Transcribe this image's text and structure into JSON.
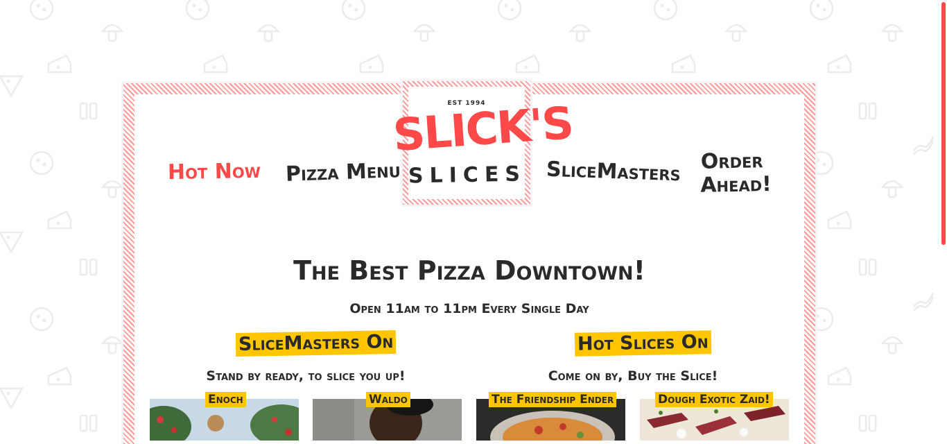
{
  "brand": {
    "established": "EST 1994",
    "name_top": "SLICK'S",
    "name_bottom": "SLICES",
    "accent_color": "#ff4949",
    "highlight_color": "#ffc600"
  },
  "nav": {
    "items": [
      {
        "label": "Hot Now",
        "active": true
      },
      {
        "label": "Pizza Menu",
        "active": false
      },
      {
        "label": "SliceMasters",
        "active": false
      },
      {
        "label": "Order Ahead!",
        "active": false
      }
    ]
  },
  "main": {
    "title": "The Best Pizza Downtown!",
    "hours": "Open 11am to 11pm Every Single Day"
  },
  "slicemasters": {
    "title": "SliceMasters On",
    "subtitle": "Stand by ready, to slice you up!",
    "people": [
      {
        "name": "Enoch",
        "icon": "photo-person-plants"
      },
      {
        "name": "Waldo",
        "icon": "photo-person-portrait"
      }
    ]
  },
  "hot_slices": {
    "title": "Hot Slices On",
    "subtitle": "Come on by, Buy the Slice!",
    "pizzas": [
      {
        "name": "The Friendship Ender",
        "icon": "photo-pizza"
      },
      {
        "name": "Dough Exotic Zaid!",
        "icon": "photo-pizza-meat"
      }
    ]
  },
  "background_icons": [
    "pizza-icon",
    "mushroom-icon",
    "cheese-icon",
    "pizza-slice-icon",
    "bottles-icon",
    "bacon-icon"
  ]
}
